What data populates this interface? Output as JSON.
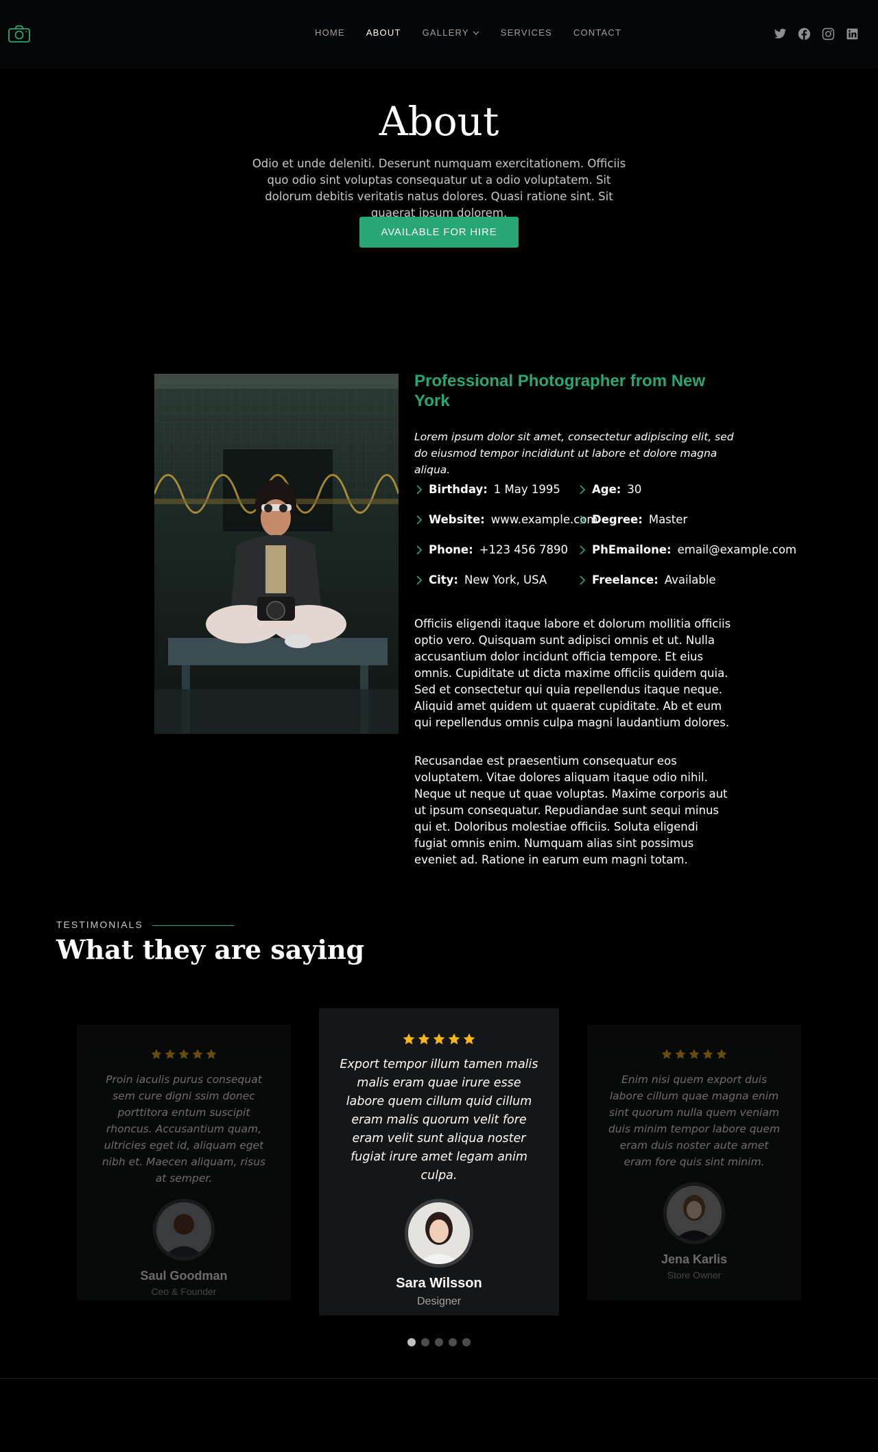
{
  "header": {
    "logo_icon": "camera-icon",
    "nav": [
      {
        "label": "HOME",
        "active": false
      },
      {
        "label": "ABOUT",
        "active": true
      },
      {
        "label": "GALLERY",
        "active": false,
        "has_dropdown": true
      },
      {
        "label": "SERVICES",
        "active": false
      },
      {
        "label": "CONTACT",
        "active": false
      }
    ],
    "socials": [
      "twitter-icon",
      "facebook-icon",
      "instagram-icon",
      "linkedin-icon"
    ]
  },
  "hero": {
    "title": "About",
    "text": "Odio et unde deleniti. Deserunt numquam exercitationem. Officiis quo odio sint voluptas consequatur ut a odio voluptatem. Sit dolorum debitis veritatis natus dolores. Quasi ratione sint. Sit quaerat ipsum dolorem.",
    "button_label": "AVAILABLE FOR HIRE"
  },
  "about": {
    "heading": "Professional Photographer from New York",
    "lead": "Lorem ipsum dolor sit amet, consectetur adipiscing elit, sed do eiusmod tempor incididunt ut labore et dolore magna aliqua.",
    "info": [
      {
        "key": "Birthday:",
        "value": "1 May 1995"
      },
      {
        "key": "Age:",
        "value": "30"
      },
      {
        "key": "Website:",
        "value": "www.example.com"
      },
      {
        "key": "Degree:",
        "value": "Master"
      },
      {
        "key": "Phone:",
        "value": "+123 456 7890"
      },
      {
        "key": "PhEmailone:",
        "value": "email@example.com"
      },
      {
        "key": "City:",
        "value": "New York, USA"
      },
      {
        "key": "Freelance:",
        "value": "Available"
      }
    ],
    "paragraph_1": "Officiis eligendi itaque labore et dolorum mollitia officiis optio vero. Quisquam sunt adipisci omnis et ut. Nulla accusantium dolor incidunt officia tempore. Et eius omnis. Cupiditate ut dicta maxime officiis quidem quia. Sed et consectetur qui quia repellendus itaque neque. Aliquid amet quidem ut quaerat cupiditate. Ab et eum qui repellendus omnis culpa magni laudantium dolores.",
    "paragraph_2": "Recusandae est praesentium consequatur eos voluptatem. Vitae dolores aliquam itaque odio nihil. Neque ut neque ut quae voluptas. Maxime corporis aut ut ipsum consequatur. Repudiandae sunt sequi minus qui et. Doloribus molestiae officiis. Soluta eligendi fugiat omnis enim. Numquam alias sint possimus eveniet ad. Ratione in earum eum magni totam."
  },
  "testimonials": {
    "label": "TESTIMONIALS",
    "title": "What they are saying",
    "items": [
      {
        "rating": 5,
        "quote": "Proin iaculis purus consequat sem cure digni ssim donec porttitora entum suscipit rhoncus. Accusantium quam, ultricies eget id, aliquam eget nibh et. Maecen aliquam, risus at semper.",
        "name": "Saul Goodman",
        "role": "Ceo & Founder"
      },
      {
        "rating": 5,
        "quote": "Export tempor illum tamen malis malis eram quae irure esse labore quem cillum quid cillum eram malis quorum velit fore eram velit sunt aliqua noster fugiat irure amet legam anim culpa.",
        "name": "Sara Wilsson",
        "role": "Designer"
      },
      {
        "rating": 5,
        "quote": "Enim nisi quem export duis labore cillum quae magna enim sint quorum nulla quem veniam duis minim tempor labore quem eram duis noster aute amet eram fore quis sint minim.",
        "name": "Jena Karlis",
        "role": "Store Owner"
      }
    ],
    "pagination": {
      "count": 5,
      "active": 0
    }
  },
  "colors": {
    "accent": "#27a776",
    "star": "#f5b619",
    "background": "#000000",
    "card": "#151617"
  }
}
